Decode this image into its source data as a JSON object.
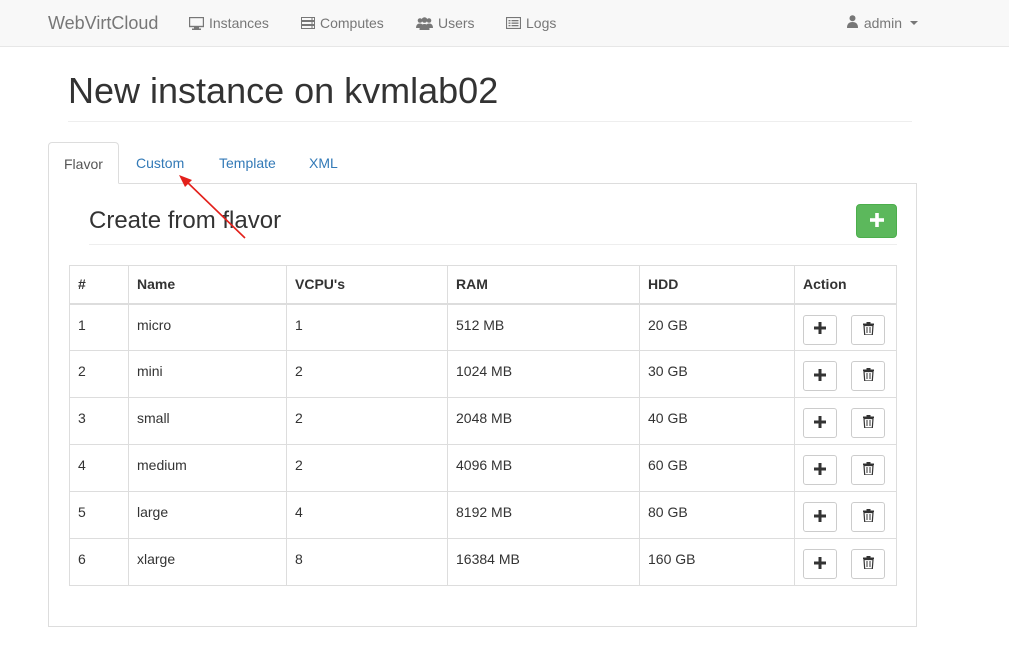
{
  "navbar": {
    "brand": "WebVirtCloud",
    "items": [
      {
        "label": "Instances",
        "icon": "monitor-icon"
      },
      {
        "label": "Computes",
        "icon": "server-icon"
      },
      {
        "label": "Users",
        "icon": "users-icon"
      },
      {
        "label": "Logs",
        "icon": "list-icon"
      }
    ],
    "user": {
      "label": "admin",
      "icon": "user-icon"
    }
  },
  "page": {
    "title": "New instance on kvmlab02"
  },
  "tabs": [
    {
      "label": "Flavor",
      "active": true
    },
    {
      "label": "Custom",
      "active": false
    },
    {
      "label": "Template",
      "active": false
    },
    {
      "label": "XML",
      "active": false
    }
  ],
  "panel": {
    "title": "Create from flavor",
    "add_button_icon": "plus-icon"
  },
  "table": {
    "headers": [
      "#",
      "Name",
      "VCPU's",
      "RAM",
      "HDD",
      "Action"
    ],
    "rows": [
      [
        "1",
        "micro",
        "1",
        "512 MB",
        "20 GB"
      ],
      [
        "2",
        "mini",
        "2",
        "1024 MB",
        "30 GB"
      ],
      [
        "3",
        "small",
        "2",
        "2048 MB",
        "40 GB"
      ],
      [
        "4",
        "medium",
        "2",
        "4096 MB",
        "60 GB"
      ],
      [
        "5",
        "large",
        "4",
        "8192 MB",
        "80 GB"
      ],
      [
        "6",
        "xlarge",
        "8",
        "16384 MB",
        "160 GB"
      ]
    ]
  },
  "colors": {
    "link": "#337ab7",
    "success": "#5cb85c",
    "annotation_arrow": "#e3201b"
  }
}
